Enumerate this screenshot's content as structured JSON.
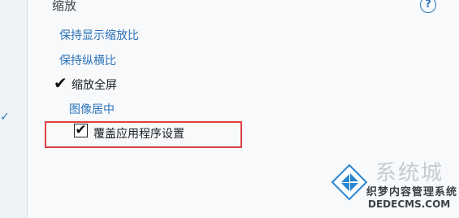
{
  "section": {
    "title": "缩放"
  },
  "options": [
    {
      "label": "保持显示缩放比",
      "style": "link"
    },
    {
      "label": "保持纵横比",
      "style": "link"
    },
    {
      "label": "缩放全屏",
      "style": "plain",
      "selected": true
    },
    {
      "label": "图像居中",
      "style": "link"
    },
    {
      "label": "覆盖应用程序设置",
      "style": "plain",
      "checked": true
    }
  ],
  "help": {
    "label": "?"
  },
  "watermark": {
    "title": "系统城",
    "line1": "织梦内容管理系统",
    "line2": "DEDECMS.COM"
  },
  "colors": {
    "link": "#2d73b9",
    "highlight": "#e0403f"
  }
}
